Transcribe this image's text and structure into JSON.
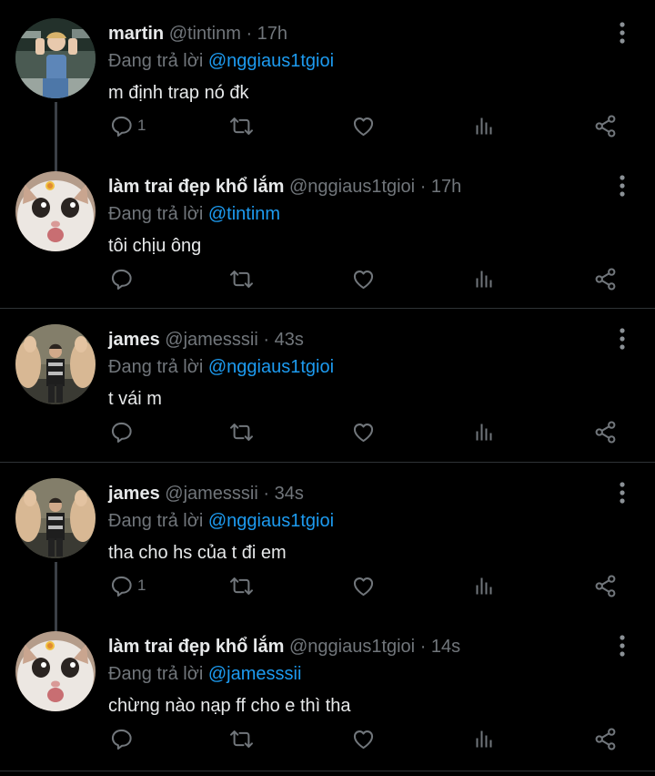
{
  "replying_prefix": "Đang trả lời",
  "tweets": [
    {
      "name": "martin",
      "handle": "@tintinm",
      "time": "· 17h",
      "replying_to": "@nggiaus1tgioi",
      "text": "m định trap nó đk",
      "reply_count": "1",
      "avatar": "photo-person-peace-sign"
    },
    {
      "name": "làm trai đẹp khổ lắm",
      "handle": "@nggiaus1tgioi",
      "time": "· 17h",
      "replying_to": "@tintinm",
      "text": "tôi chịu ông",
      "reply_count": "",
      "avatar": "photo-cat"
    },
    {
      "name": "james",
      "handle": "@jamesssii",
      "time": "· 43s",
      "replying_to": "@nggiaus1tgioi",
      "text": "t vái m",
      "reply_count": "",
      "avatar": "photo-person-thumbs-up"
    },
    {
      "name": "james",
      "handle": "@jamesssii",
      "time": "· 34s",
      "replying_to": "@nggiaus1tgioi",
      "text": "tha cho hs của t đi em",
      "reply_count": "1",
      "avatar": "photo-person-thumbs-up"
    },
    {
      "name": "làm trai đẹp khổ lắm",
      "handle": "@nggiaus1tgioi",
      "time": "· 14s",
      "replying_to": "@jamesssii",
      "text": "chừng nào nạp ff cho e thì tha",
      "reply_count": "",
      "avatar": "photo-cat"
    }
  ],
  "icons": {
    "reply": "comment-icon",
    "retweet": "retweet-icon",
    "like": "heart-icon",
    "views": "analytics-icon",
    "share": "share-icon",
    "more": "more-vertical-icon"
  },
  "colors": {
    "background": "#000000",
    "text_primary": "#e7e9ea",
    "text_secondary": "#71767b",
    "mention": "#1d9bf0",
    "divider": "#2f3336"
  }
}
